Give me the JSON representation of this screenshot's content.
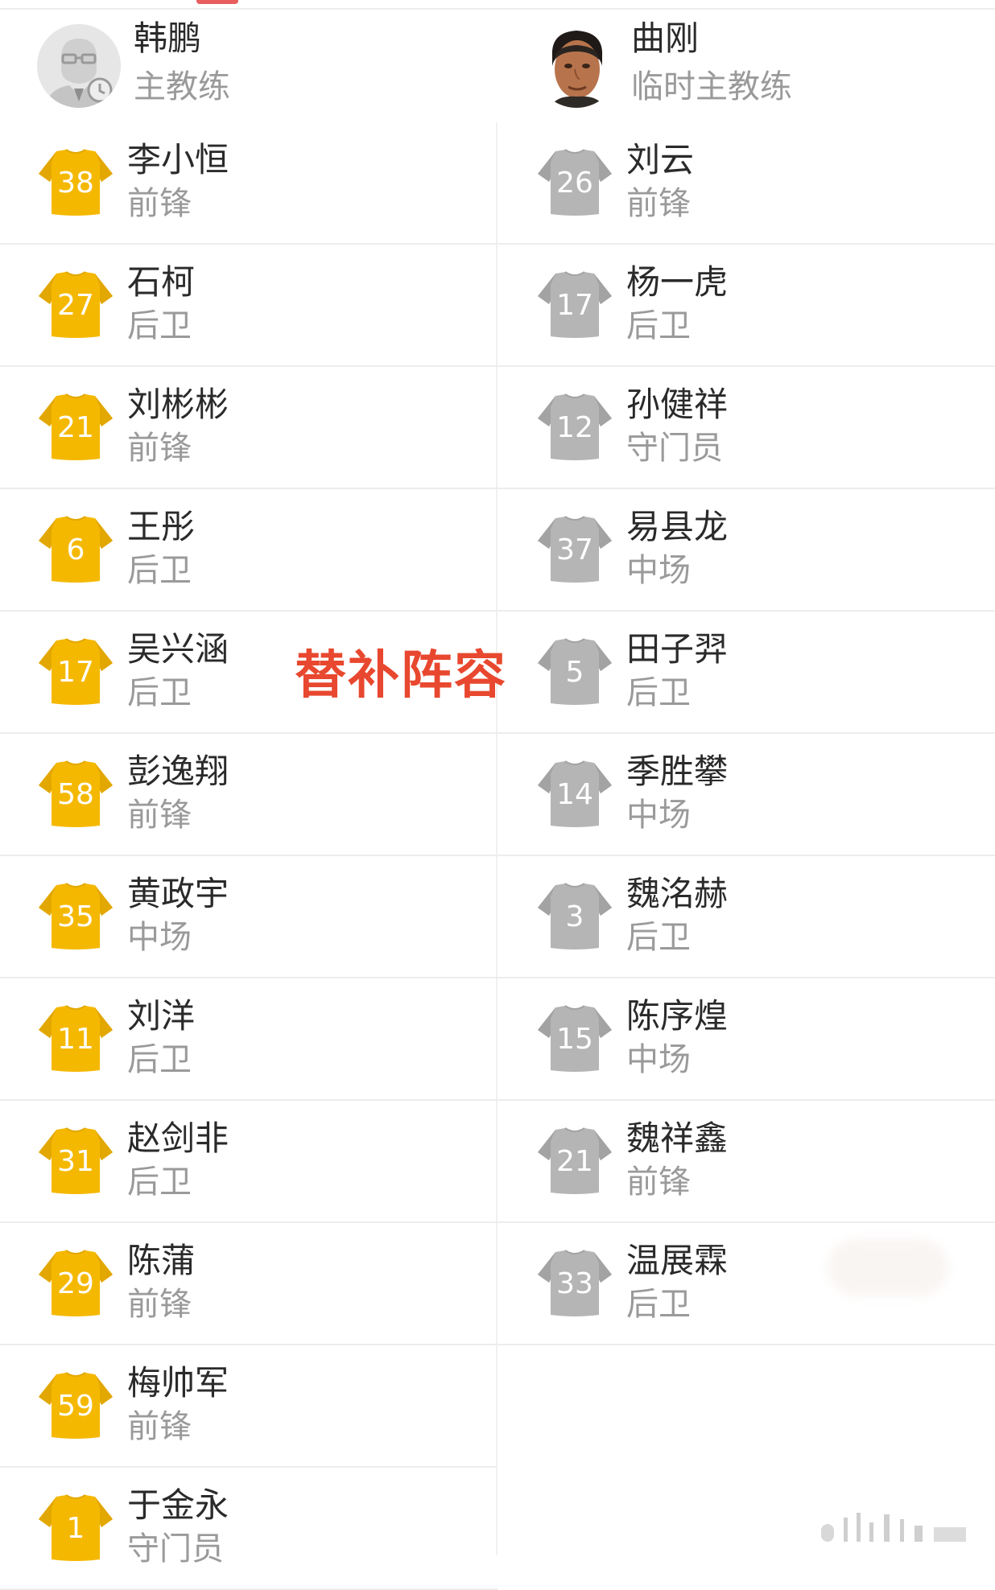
{
  "coaches": {
    "home": {
      "name": "韩鹏",
      "role": "主教练",
      "avatar_icon": "coach-placeholder-icon"
    },
    "away": {
      "name": "曲刚",
      "role": "临时主教练",
      "avatar_icon": "coach-photo"
    }
  },
  "overlay_label": "替补阵容",
  "colors": {
    "home_shirt": "#f5b800",
    "home_shirt_dark": "#e2a700",
    "away_shirt": "#b5b5b5",
    "away_shirt_dark": "#a3a3a3",
    "overlay_text": "#e8482f"
  },
  "home_players": [
    {
      "number": "38",
      "name": "李小恒",
      "position": "前锋"
    },
    {
      "number": "27",
      "name": "石柯",
      "position": "后卫"
    },
    {
      "number": "21",
      "name": "刘彬彬",
      "position": "前锋"
    },
    {
      "number": "6",
      "name": "王彤",
      "position": "后卫"
    },
    {
      "number": "17",
      "name": "吴兴涵",
      "position": "后卫"
    },
    {
      "number": "58",
      "name": "彭逸翔",
      "position": "前锋"
    },
    {
      "number": "35",
      "name": "黄政宇",
      "position": "中场"
    },
    {
      "number": "11",
      "name": "刘洋",
      "position": "后卫"
    },
    {
      "number": "31",
      "name": "赵剑非",
      "position": "后卫"
    },
    {
      "number": "29",
      "name": "陈蒲",
      "position": "前锋"
    },
    {
      "number": "59",
      "name": "梅帅军",
      "position": "前锋"
    },
    {
      "number": "1",
      "name": "于金永",
      "position": "守门员"
    }
  ],
  "away_players": [
    {
      "number": "26",
      "name": "刘云",
      "position": "前锋"
    },
    {
      "number": "17",
      "name": "杨一虎",
      "position": "后卫"
    },
    {
      "number": "12",
      "name": "孙健祥",
      "position": "守门员"
    },
    {
      "number": "37",
      "name": "易县龙",
      "position": "中场"
    },
    {
      "number": "5",
      "name": "田子羿",
      "position": "后卫"
    },
    {
      "number": "14",
      "name": "季胜攀",
      "position": "中场"
    },
    {
      "number": "3",
      "name": "魏洺赫",
      "position": "后卫"
    },
    {
      "number": "15",
      "name": "陈序煌",
      "position": "中场"
    },
    {
      "number": "21",
      "name": "魏祥鑫",
      "position": "前锋"
    },
    {
      "number": "33",
      "name": "温展霖",
      "position": "后卫"
    }
  ]
}
